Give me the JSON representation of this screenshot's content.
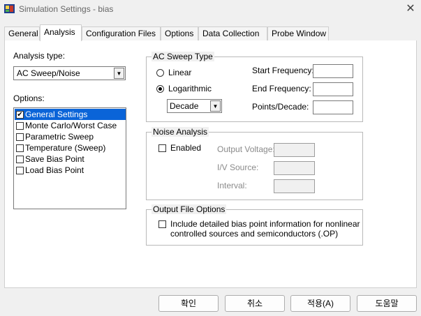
{
  "window": {
    "title": "Simulation Settings - bias",
    "close_glyph": "✕"
  },
  "tabs": [
    {
      "label": "General"
    },
    {
      "label": "Analysis"
    },
    {
      "label": "Configuration Files"
    },
    {
      "label": "Options"
    },
    {
      "label": "Data Collection"
    },
    {
      "label": "Probe Window"
    }
  ],
  "active_tab": "Analysis",
  "analysis": {
    "type_label": "Analysis type:",
    "type_value": "AC Sweep/Noise",
    "options_label": "Options:",
    "options": [
      {
        "label": "General Settings",
        "checked": true,
        "selected": true
      },
      {
        "label": "Monte Carlo/Worst Case",
        "checked": false
      },
      {
        "label": "Parametric Sweep",
        "checked": false
      },
      {
        "label": "Temperature (Sweep)",
        "checked": false
      },
      {
        "label": "Save Bias Point",
        "checked": false
      },
      {
        "label": "Load Bias Point",
        "checked": false
      }
    ]
  },
  "ac_sweep": {
    "title": "AC Sweep Type",
    "linear_label": "Linear",
    "log_label": "Logarithmic",
    "selected": "Logarithmic",
    "log_unit": "Decade",
    "start_freq_label": "Start Frequency:",
    "end_freq_label": "End Frequency:",
    "points_label": "Points/Decade:",
    "start_freq_value": "",
    "end_freq_value": "",
    "points_value": ""
  },
  "noise": {
    "title": "Noise Analysis",
    "enabled_label": "Enabled",
    "enabled": false,
    "output_voltage_label": "Output Voltage:",
    "iv_source_label": "I/V Source:",
    "interval_label": "Interval:"
  },
  "output_file": {
    "title": "Output File Options",
    "line1": "Include detailed bias point information for nonlinear",
    "line2": "controlled sources and semiconductors (.OP)",
    "checked": false
  },
  "buttons": {
    "ok": "확인",
    "cancel": "취소",
    "apply": "적용(A)",
    "help": "도움말"
  },
  "colors": {
    "selection": "#0a64d8",
    "window_bg": "#f0f0f0"
  },
  "icons": {
    "app": "pspice-app-icon",
    "dropdown": "chevron-down-icon",
    "check": "checkmark-icon"
  }
}
